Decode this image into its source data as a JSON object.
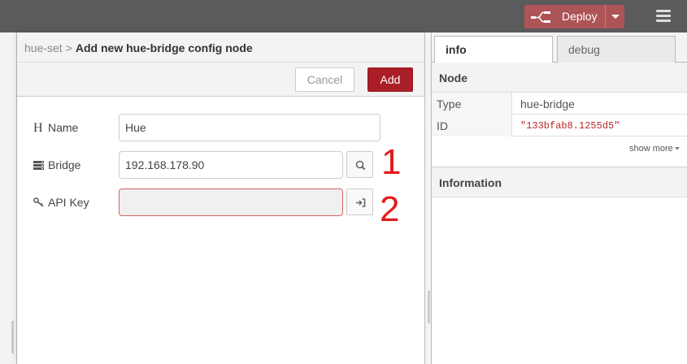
{
  "header": {
    "deploy_label": "Deploy",
    "colors": {
      "background": "#5b5b5b",
      "deploy": "#ad5457"
    }
  },
  "tray": {
    "breadcrumb": {
      "parent": "hue-set",
      "separator": ">",
      "current": "Add new hue-bridge config node"
    },
    "buttons": {
      "cancel": "Cancel",
      "add": "Add"
    },
    "fields": {
      "name": {
        "icon": "heading-icon",
        "label": "Name",
        "value": "Hue"
      },
      "bridge": {
        "icon": "server-icon",
        "label": "Bridge",
        "value": "192.168.178.90",
        "button_icon": "search-icon"
      },
      "api_key": {
        "icon": "key-icon",
        "label": "API Key",
        "value": "",
        "button_icon": "sign-in-icon"
      }
    },
    "annotations": {
      "one": "1",
      "two": "2"
    }
  },
  "sidebar": {
    "tabs": [
      {
        "label": "info",
        "active": true
      },
      {
        "label": "debug",
        "active": false
      }
    ],
    "node_section": "Node",
    "rows": [
      {
        "key": "Type",
        "value": "hue-bridge"
      },
      {
        "key": "ID",
        "value": "\"133bfab8.1255d5\""
      }
    ],
    "show_more": "show more",
    "information_section": "Information"
  }
}
